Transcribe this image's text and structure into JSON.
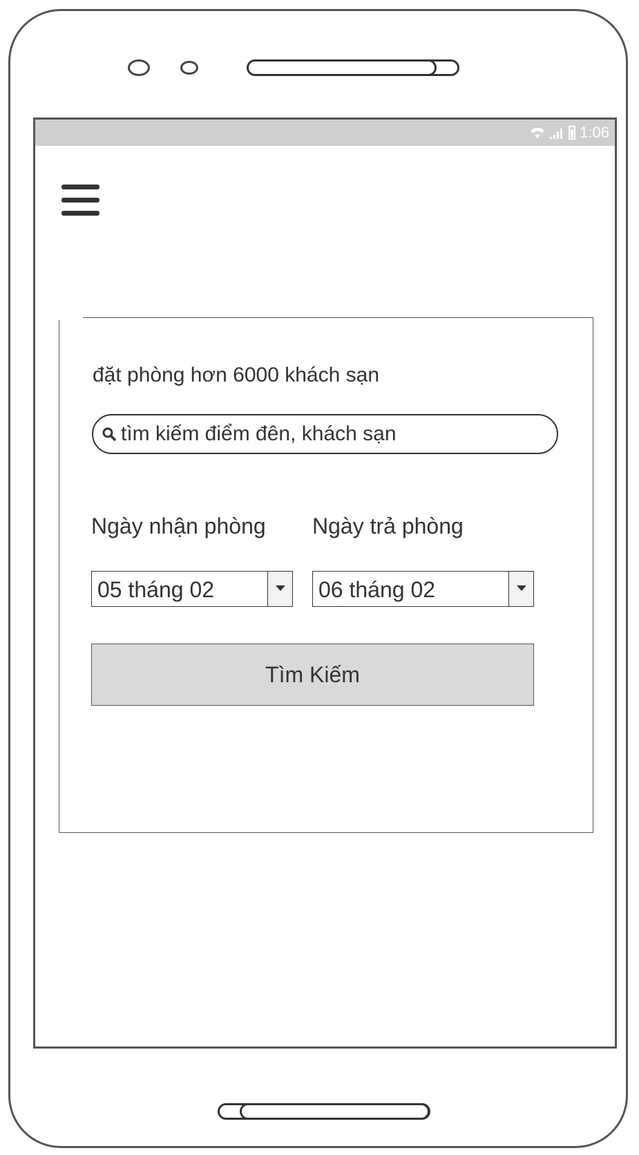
{
  "status_bar": {
    "time": "1:06",
    "icons": [
      "wifi-icon",
      "signal-icon",
      "battery-icon"
    ]
  },
  "menu": {
    "icon": "hamburger-menu-icon"
  },
  "booking": {
    "headline": "đặt phòng hơn 6000 khách sạn",
    "search": {
      "placeholder": "tìm kiếm điểm đên, khách sạn",
      "value": "",
      "icon": "search-icon"
    },
    "checkin": {
      "label": "Ngày nhận phòng",
      "selected": "05 tháng 02"
    },
    "checkout": {
      "label": "Ngày trả phòng",
      "selected": "06 tháng 02"
    },
    "search_button": "Tìm Kiếm"
  },
  "colors": {
    "status_bar": "#cfcfcf",
    "button_bg": "#d9d9d9",
    "text": "#333333",
    "frame": "#555555"
  }
}
